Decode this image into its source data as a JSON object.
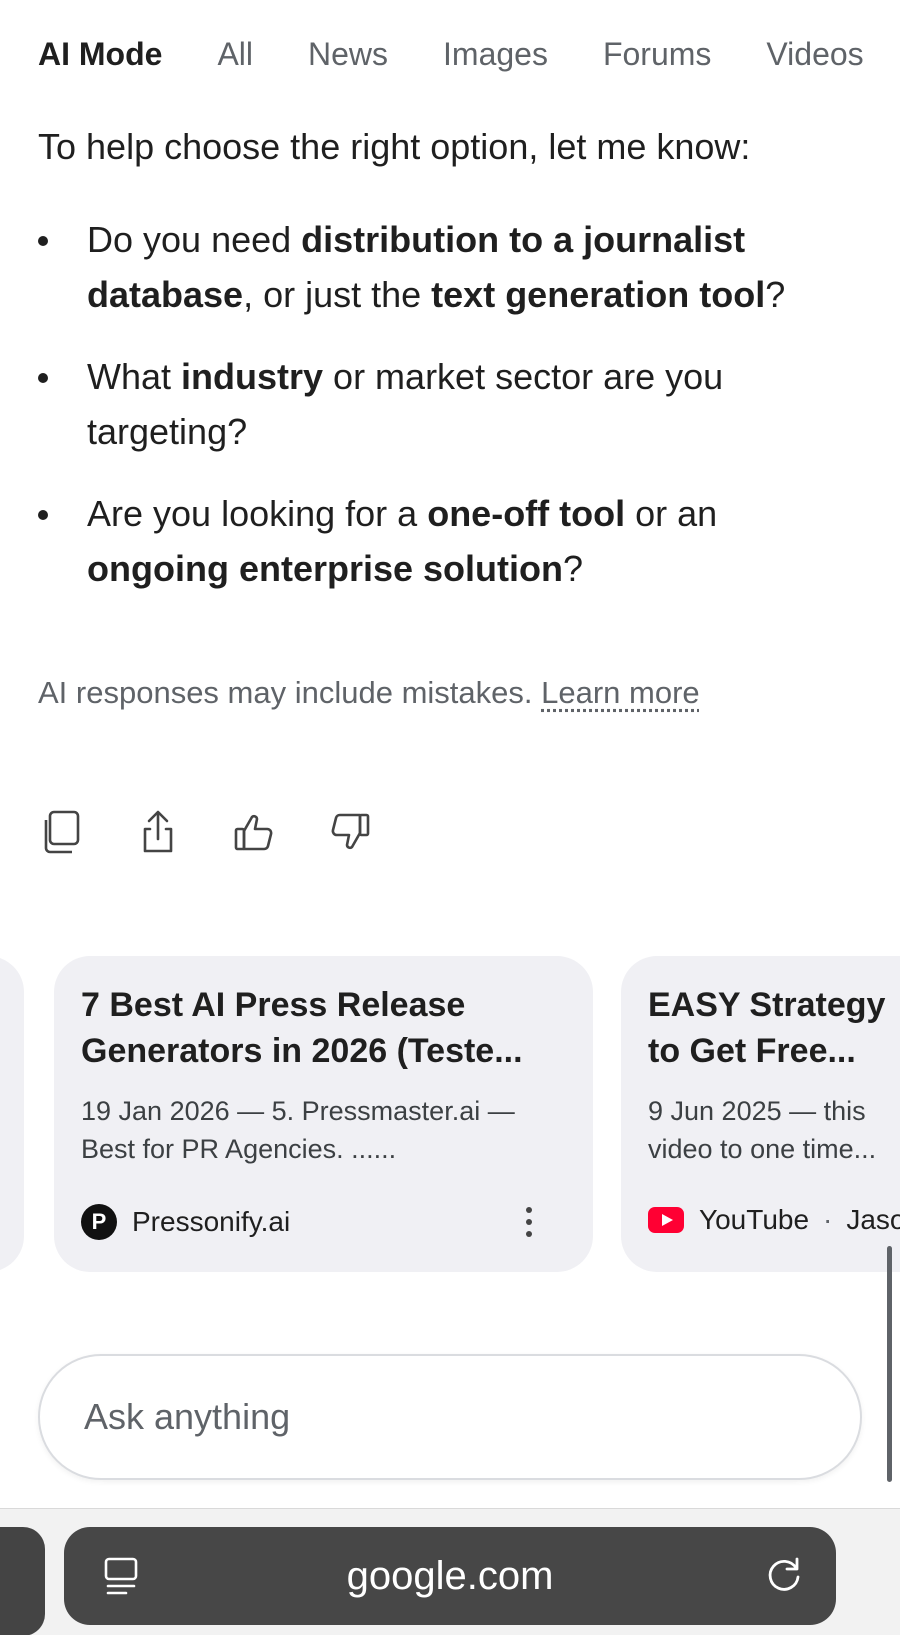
{
  "tabs": [
    {
      "label": "AI Mode",
      "active": true
    },
    {
      "label": "All"
    },
    {
      "label": "News"
    },
    {
      "label": "Images"
    },
    {
      "label": "Forums"
    },
    {
      "label": "Videos"
    }
  ],
  "intro": "To help choose the right option, let me know:",
  "bullets": [
    {
      "parts": [
        "Do you need ",
        "distribution to a journalist database",
        ", or just the ",
        "text generation tool",
        "?"
      ]
    },
    {
      "parts": [
        "What ",
        "industry",
        " or market sector are you targeting?"
      ]
    },
    {
      "parts": [
        "Are you looking for a ",
        "one-off tool",
        " or an ",
        "ongoing enterprise solution",
        "?"
      ]
    }
  ],
  "disclaimer": {
    "text": "AI responses may include mistakes.",
    "link": "Learn more"
  },
  "actions": [
    {
      "icon": "copy-icon"
    },
    {
      "icon": "share-icon"
    },
    {
      "icon": "thumbs-up-icon"
    },
    {
      "icon": "thumbs-down-icon"
    }
  ],
  "cards": [
    {
      "title": "7 Best AI Press Release Generators in 2026 (Teste...",
      "snippet": "19 Jan 2026 — 5. Pressmaster.ai — Best for PR Agencies. ......",
      "source": "Pressonify.ai",
      "source_logo_letter": "P"
    },
    {
      "title": "EASY Strategy to Get Free...",
      "snippet": "9 Jun 2025 — this video to one time...",
      "source": "YouTube",
      "author": "Jaso"
    }
  ],
  "ask": {
    "placeholder": "Ask anything"
  },
  "browser": {
    "url": "google.com"
  },
  "colors": {
    "brand_youtube": "#ff0033",
    "urlbar": "#474747",
    "card_bg": "#f0f0f4"
  }
}
